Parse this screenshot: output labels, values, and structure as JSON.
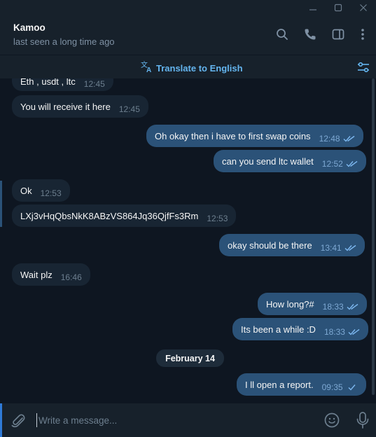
{
  "chat": {
    "name": "Kamoo",
    "status": "last seen a long time ago"
  },
  "translate": {
    "label": "Translate to English"
  },
  "messages": [
    {
      "text": "Eth , usdt , ltc",
      "time": "12:45",
      "direction": "in"
    },
    {
      "text": "You will receive it here",
      "time": "12:45",
      "direction": "in"
    },
    {
      "text": "Oh okay then i have to first swap coins",
      "time": "12:48",
      "direction": "out",
      "read": true
    },
    {
      "text": "can you send ltc wallet",
      "time": "12:52",
      "direction": "out",
      "read": true
    },
    {
      "text": "Ok",
      "time": "12:53",
      "direction": "in"
    },
    {
      "text": "LXj3vHqQbsNkK8ABzVS864Jq36QjfFs3Rm",
      "time": "12:53",
      "direction": "in"
    },
    {
      "text": "okay should be there",
      "time": "13:41",
      "direction": "out",
      "read": true
    },
    {
      "text": "Wait plz",
      "time": "16:46",
      "direction": "in"
    },
    {
      "text": "How long?#",
      "time": "18:33",
      "direction": "out",
      "read": true
    },
    {
      "text": "Its been a while :D",
      "time": "18:33",
      "direction": "out",
      "read": true
    },
    {
      "text": "I ll open a report.",
      "time": "09:35",
      "direction": "out",
      "read": false
    }
  ],
  "date_separator": "February 14",
  "composer": {
    "placeholder": "Write a message..."
  },
  "icons": {
    "header": [
      "search-icon",
      "phone-icon",
      "sidebar-toggle-icon",
      "more-vertical-icon"
    ],
    "composer": [
      "attach-icon",
      "emoji-icon",
      "microphone-icon"
    ]
  },
  "colors": {
    "background": "#0e1621",
    "panel": "#17212b",
    "incoming_bubble": "#182533",
    "outgoing_bubble": "#2b5278",
    "accent": "#64b5ef"
  }
}
